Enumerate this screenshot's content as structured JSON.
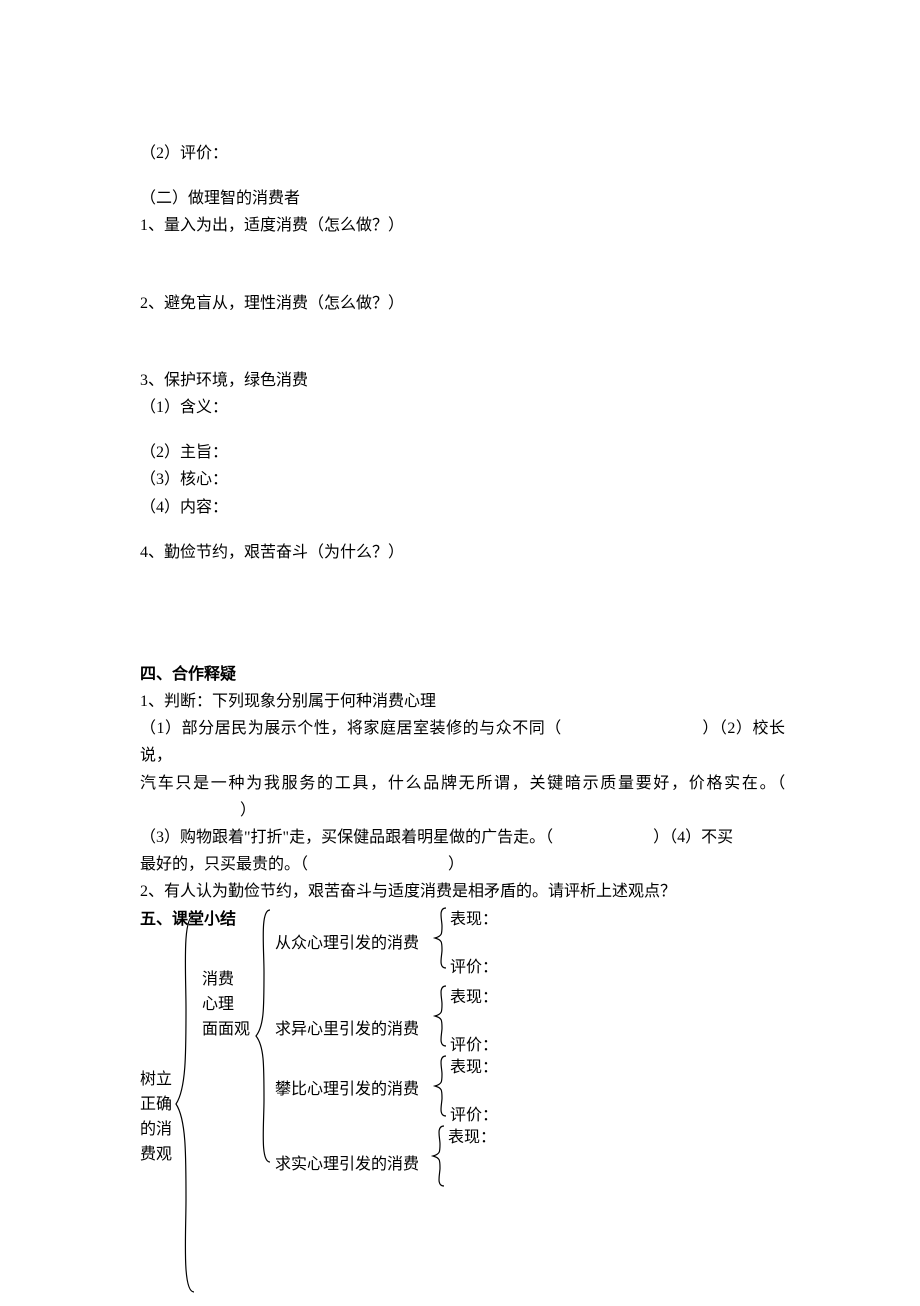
{
  "items": {
    "i2_eval": "（2）评价：",
    "sec2_title": "（二）做理智的消费者",
    "s1": "1、量入为出，适度消费（怎么做？）",
    "s2": "2、避免盲从，理性消费（怎么做？）",
    "s3": "3、保护环境，绿色消费",
    "s3_1": "（1）含义：",
    "s3_2": "（2）主旨：",
    "s3_3": "（3）核心：",
    "s3_4": "（4）内容：",
    "s4": "4、勤俭节约，艰苦奋斗（为什么？）"
  },
  "section4_title": "四、合作释疑",
  "q1_intro": "1、判断：下列现象分别属于何种消费心理",
  "q1_1a": "（1）部分居民为展示个性，将家庭居室装修的与众不同（",
  "q1_1b": "）（2）校长说，",
  "q1_line2a": "汽车只是一种为我服务的工具，什么品牌无所谓，关键暗示质量要好，价格实在。（",
  "q1_line2b": "）",
  "q1_3a": "（3）购物跟着\"打折\"走，买保健品跟着明星做的广告走。（",
  "q1_3b": "）（4）不买",
  "q1_4a": "最好的，只买最贵的。（",
  "q1_4b": "）",
  "q2": "2、有人认为勤俭节约，艰苦奋斗与适度消费是相矛盾的。请评析上述观点？",
  "section5_title": "五、课堂小结",
  "tree": {
    "root1": "树立",
    "root2": "正确",
    "root3": "的消",
    "root4": "费观",
    "b1_1": "消费",
    "b1_2": "心理",
    "b1_3": "面面观",
    "leaf1": "从众心理引发的消费",
    "leaf2": "求异心里引发的消费",
    "leaf3": "攀比心理引发的消费",
    "leaf4": "求实心理引发的消费",
    "show": "表现：",
    "eval": "评价："
  }
}
